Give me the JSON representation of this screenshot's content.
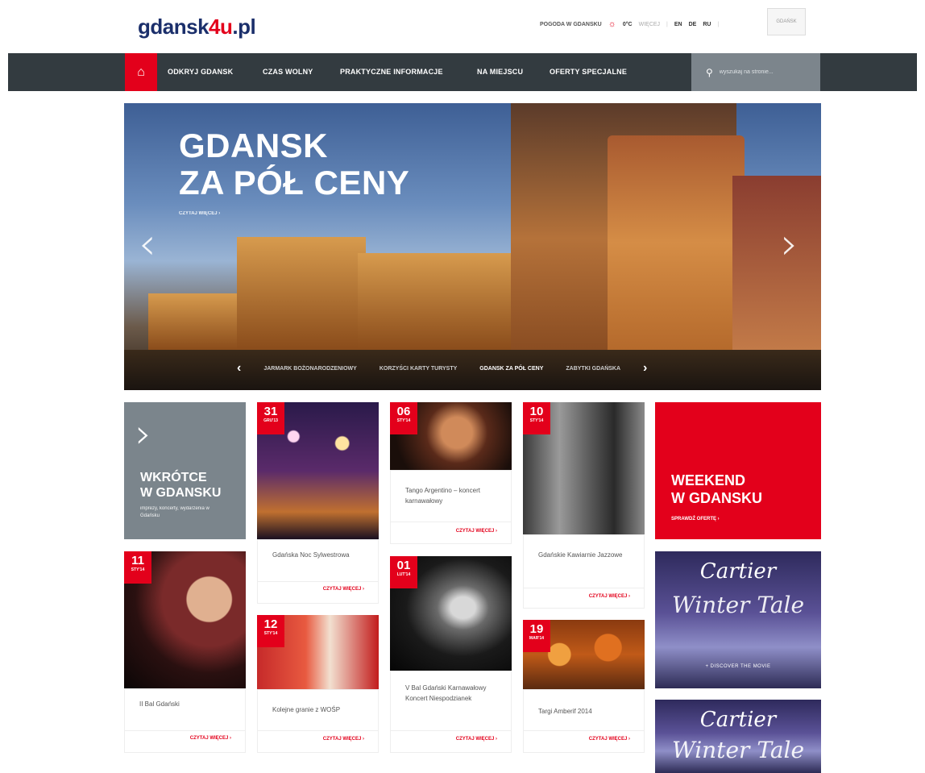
{
  "header": {
    "logo_main": "gdansk",
    "logo_accent": "4u",
    "logo_tld": ".pl",
    "weather_label": "POGODA W GDANSKU",
    "weather_icon": "sun-icon",
    "temperature": "0°C",
    "weather_extra": "WIĘCEJ",
    "languages": [
      "EN",
      "DE",
      "RU"
    ],
    "crest_label": "GDAŃSK"
  },
  "nav": {
    "home_icon": "home-icon",
    "items": [
      "ODKRYJ GDANSK",
      "CZAS WOLNY",
      "PRAKTYCZNE INFORMACJE",
      "NA MIEJSCU",
      "OFERTY SPECJALNE"
    ],
    "search_placeholder": "wyszukaj na stronie..."
  },
  "hero": {
    "title_line1": "GDANSK",
    "title_line2": "ZA PÓŁ CENY",
    "more": "CZYTAJ WIĘCEJ ›",
    "prev_arrow": "‹",
    "next_arrow": "›",
    "slides": [
      "JARMARK BOŻONARODZENIOWY",
      "KORZYŚCI KARTY TURYSTY",
      "GDANSK ZA PÓŁ CENY",
      "ZABYTKI GDAŃSKA"
    ],
    "active_slide": "GDANSK ZA PÓŁ CENY"
  },
  "promo": {
    "chevron": "›",
    "title_line1": "WKRÓTCE",
    "title_line2": "W GDANSKU",
    "subtitle": "imprezy, koncerty, wydarzenia w Gdańsku"
  },
  "weekend": {
    "title_line1": "WEEKEND",
    "title_line2": "W GDANSKU",
    "cta": "SPRAWDŹ OFERTĘ ›"
  },
  "read_more": "CZYTAJ WIĘCEJ ›",
  "events": [
    {
      "day": "31",
      "month": "GRU'13",
      "title": "Gdańska Noc Sylwestrowa"
    },
    {
      "day": "06",
      "month": "STY'14",
      "title": "Tango Argentino – koncert karnawałowy"
    },
    {
      "day": "10",
      "month": "STY'14",
      "title": "Gdańskie Kawiarnie Jazzowe"
    },
    {
      "day": "11",
      "month": "STY'14",
      "title": "II Bal Gdański"
    },
    {
      "day": "12",
      "month": "STY'14",
      "title": "Kolejne granie z WOŚP"
    },
    {
      "day": "01",
      "month": "LUT'14",
      "title": "V Bal Gdański Karnawałowy Koncert Niespodzianek"
    },
    {
      "day": "19",
      "month": "MAR'14",
      "title": "Targi Amberif 2014"
    }
  ],
  "ads": [
    {
      "brand": "Cartier",
      "script": "Winter Tale",
      "cta": "+ DISCOVER THE MOVIE"
    },
    {
      "brand": "Cartier",
      "script": "Winter Tale"
    }
  ],
  "colors": {
    "accent": "#e3001b",
    "nav": "#333b40",
    "grey_tile": "#7b858c",
    "logo": "#1b2f6b"
  }
}
